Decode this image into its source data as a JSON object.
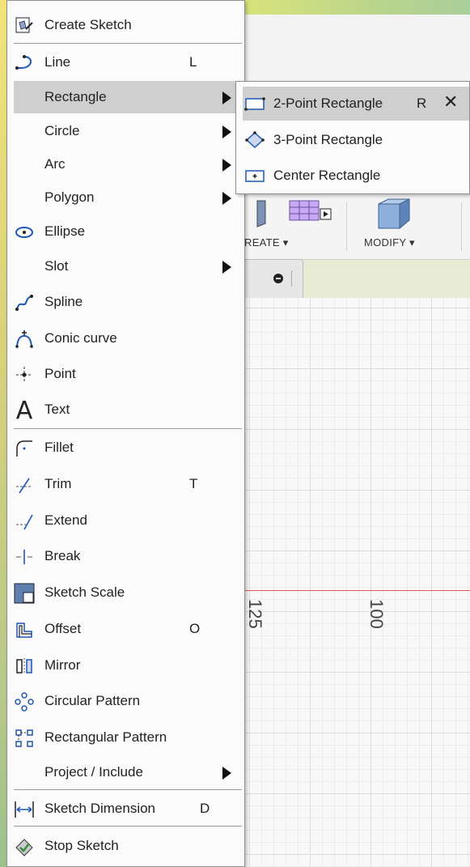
{
  "menu": {
    "items": [
      {
        "label": "Create Sketch",
        "icon": "create-sketch-icon"
      },
      {
        "label": "Line",
        "shortcut": "L",
        "icon": "line-icon"
      },
      {
        "label": "Rectangle",
        "has_submenu": true,
        "highlighted": true
      },
      {
        "label": "Circle",
        "has_submenu": true
      },
      {
        "label": "Arc",
        "has_submenu": true
      },
      {
        "label": "Polygon",
        "has_submenu": true
      },
      {
        "label": "Ellipse",
        "icon": "ellipse-icon"
      },
      {
        "label": "Slot",
        "has_submenu": true
      },
      {
        "label": "Spline",
        "icon": "spline-icon"
      },
      {
        "label": "Conic curve",
        "icon": "conic-curve-icon"
      },
      {
        "label": "Point",
        "icon": "point-icon"
      },
      {
        "label": "Text",
        "icon": "text-icon"
      },
      {
        "label": "Fillet",
        "icon": "fillet-icon"
      },
      {
        "label": "Trim",
        "shortcut": "T",
        "icon": "trim-icon"
      },
      {
        "label": "Extend",
        "icon": "extend-icon"
      },
      {
        "label": "Break",
        "icon": "break-icon"
      },
      {
        "label": "Sketch Scale",
        "icon": "sketch-scale-icon"
      },
      {
        "label": "Offset",
        "shortcut": "O",
        "icon": "offset-icon"
      },
      {
        "label": "Mirror",
        "icon": "mirror-icon"
      },
      {
        "label": "Circular Pattern",
        "icon": "circular-pattern-icon"
      },
      {
        "label": "Rectangular Pattern",
        "icon": "rectangular-pattern-icon"
      },
      {
        "label": "Project / Include",
        "has_submenu": true
      },
      {
        "label": "Sketch Dimension",
        "shortcut": "D",
        "icon": "sketch-dimension-icon"
      },
      {
        "label": "Stop Sketch",
        "icon": "stop-sketch-icon"
      }
    ]
  },
  "submenu": {
    "items": [
      {
        "label": "2-Point Rectangle",
        "shortcut": "R",
        "close": "✕",
        "highlighted": true,
        "icon": "two-point-rectangle-icon"
      },
      {
        "label": "3-Point Rectangle",
        "icon": "three-point-rectangle-icon"
      },
      {
        "label": "Center Rectangle",
        "icon": "center-rectangle-icon"
      }
    ]
  },
  "toolbar": {
    "create_label": "REATE ▾",
    "modify_label": "MODIFY ▾"
  },
  "canvas": {
    "axis_label_1": "125",
    "axis_label_2": "100",
    "axis_color": "#e05a5a"
  },
  "colors": {
    "highlight": "#cfcfcf",
    "menu_bg": "#fbfbfb"
  }
}
